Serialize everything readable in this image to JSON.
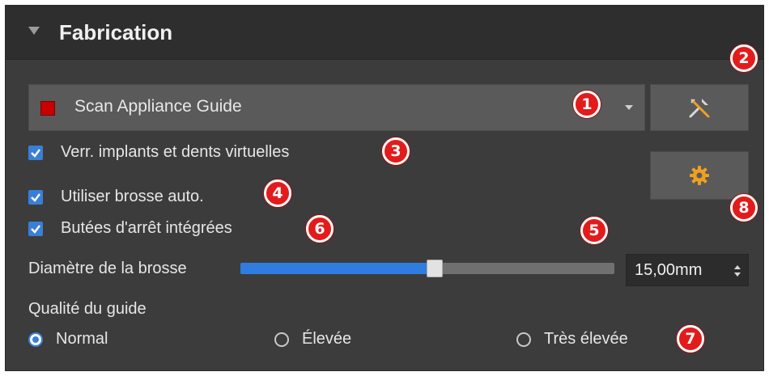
{
  "panel": {
    "title": "Fabrication",
    "collapse_icon": "triangle-down-icon"
  },
  "guide_select": {
    "value": "Scan Appliance Guide",
    "swatch_color": "#c80000",
    "arrow_icon": "chevron-down-icon"
  },
  "buttons": {
    "tools_icon": "tools-icon",
    "settings_icon": "gear-icon",
    "accent_color": "#f0a020"
  },
  "checkboxes": [
    {
      "label": "Verr. implants et dents virtuelles",
      "checked": true
    },
    {
      "label": "Utiliser brosse auto.",
      "checked": true
    },
    {
      "label": "Butées d'arrêt intégrées",
      "checked": true
    }
  ],
  "brush": {
    "label": "Diamètre de la brosse",
    "slider_fraction": 0.52,
    "value": "15,00mm"
  },
  "quality": {
    "label": "Qualité du guide",
    "options": [
      "Normal",
      "Élevée",
      "Très élevée"
    ],
    "selected": "Normal"
  },
  "markers": [
    "1",
    "2",
    "3",
    "4",
    "5",
    "6",
    "7",
    "8"
  ],
  "colors": {
    "panel_bg": "#3c3c3c",
    "header_bg": "#2e2e2e",
    "accent_blue": "#2f7de1",
    "marker_red": "#e31b1b"
  }
}
